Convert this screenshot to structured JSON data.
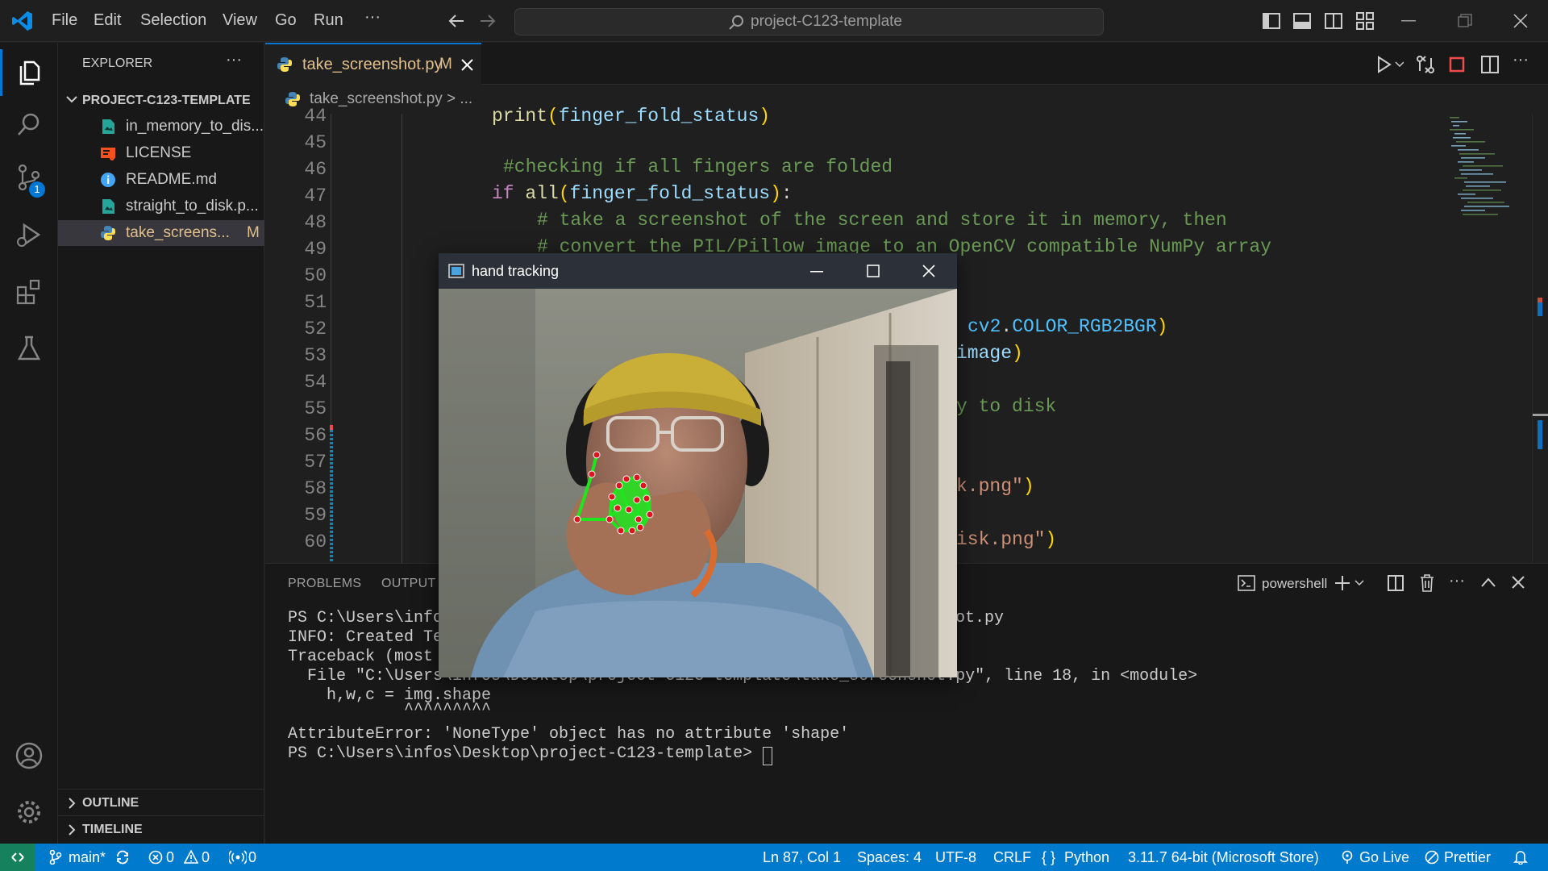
{
  "titlebar": {
    "menu": [
      "File",
      "Edit",
      "Selection",
      "View",
      "Go",
      "Run",
      "···"
    ],
    "search": "project-C123-template"
  },
  "activity": {
    "scm_badge": "1"
  },
  "sidebar": {
    "title": "EXPLORER",
    "more": "···",
    "project": "PROJECT-C123-TEMPLATE",
    "files": [
      {
        "name": "in_memory_to_dis...",
        "status": "",
        "icon": "image-file-icon"
      },
      {
        "name": "LICENSE",
        "status": "",
        "icon": "license-icon"
      },
      {
        "name": "README.md",
        "status": "",
        "icon": "info-icon"
      },
      {
        "name": "straight_to_disk.p...",
        "status": "",
        "icon": "image-file-icon"
      },
      {
        "name": "take_screens...",
        "status": "M",
        "icon": "python-icon"
      }
    ],
    "outline": "OUTLINE",
    "timeline": "TIMELINE"
  },
  "editor": {
    "tab_label": "take_screenshot.py",
    "tab_status": "M",
    "breadcrumb_file": "take_screenshot.py",
    "breadcrumb_rest": "> ...",
    "line_numbers": [
      "44",
      "45",
      "46",
      "47",
      "48",
      "49",
      "50",
      "51",
      "52",
      "53",
      "54",
      "55",
      "56",
      "57",
      "58",
      "59",
      "60"
    ]
  },
  "panel": {
    "tabs": [
      "PROBLEMS",
      "OUTPUT"
    ],
    "terminal_name": "powershell",
    "lines": [
      "PS C:\\Users\\info",
      "INFO: Created Te",
      "Traceback (most ",
      "  File \"C:\\Users\\infos\\Desktop\\project-C123-template\\take_screenshot.py\", line 18, in <module>",
      "    h,w,c = img.shape",
      "            ^^^^^^^^^",
      "",
      "AttributeError: 'NoneType' object has no attribute 'shape'",
      "PS C:\\Users\\infos\\Desktop\\project-C123-template> "
    ],
    "line0_tail": "ot.py"
  },
  "statusbar": {
    "branch": "main*",
    "errors": "0",
    "warnings": "0",
    "ports": "0",
    "position": "Ln 87, Col 1",
    "spaces": "Spaces: 4",
    "encoding": "UTF-8",
    "eol": "CRLF",
    "language": "Python",
    "interpreter": "3.11.7 64-bit (Microsoft Store)",
    "golive": "Go Live",
    "prettier": "Prettier"
  },
  "hand_window": {
    "title": "hand tracking"
  },
  "colors": {
    "accent": "#0078d4",
    "statusbar": "#007acc",
    "modified": "#e2c08d"
  }
}
